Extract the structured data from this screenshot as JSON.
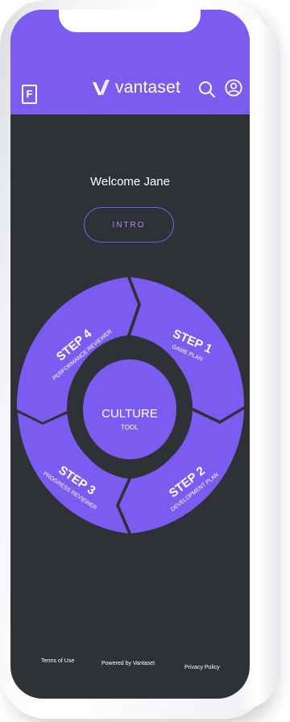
{
  "header": {
    "menu_label": "F",
    "brand": "vantaset",
    "icons": [
      "search-icon",
      "user-icon"
    ],
    "accent_color": "#7c5cf0"
  },
  "main": {
    "welcome": "Welcome Jane",
    "intro_label": "INTRO",
    "center": {
      "title": "CULTURE",
      "subtitle": "TOOL"
    },
    "steps": [
      {
        "title": "STEP 1",
        "subtitle": "GAME PLAN"
      },
      {
        "title": "STEP 2",
        "subtitle": "DEVELOPMENT PLAN"
      },
      {
        "title": "STEP 3",
        "subtitle": "PROGRESS REVIEWER"
      },
      {
        "title": "STEP 4",
        "subtitle": "PERFORMANCE REVIEWER"
      }
    ]
  },
  "footer": {
    "terms": "Terms of Use",
    "powered": "Powered by Vantaset",
    "privacy": "Privacy Policy"
  }
}
